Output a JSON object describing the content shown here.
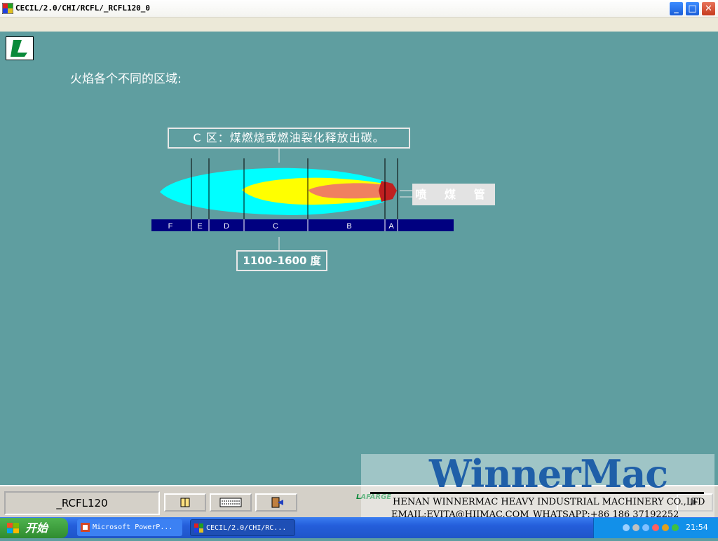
{
  "window": {
    "title": "CECIL/2.0/CHI/RCFL/_RCFL120_0",
    "minimize_glyph": "_",
    "maximize_glyph": "□",
    "close_glyph": "✕"
  },
  "content": {
    "heading": "火焰各个不同的区域:",
    "callout_top": "C 区：煤燃烧或燃油裂化释放出碳。",
    "callout_bottom": "1100–1600 度",
    "burner_label": "喷 煤 管",
    "zones": [
      "F",
      "E",
      "D",
      "C",
      "B",
      "A"
    ]
  },
  "toolbar": {
    "module_name": "_RCFL120",
    "lafarge_text": "LAFARGE",
    "next_glyph": "▶"
  },
  "watermark": {
    "brand_initial": "W",
    "brand_rest": "innerMac",
    "company": "HENAN WINNERMAC HEAVY INDUSTRIAL MACHINERY CO.,LTD",
    "email": "EMAIL:EVITA@HIIMAC.COM",
    "whatsapp": "WHATSAPP:+86 186 37192252"
  },
  "taskbar": {
    "start_label": "开始",
    "tasks": [
      {
        "label": "Microsoft PowerP..."
      },
      {
        "label": "CECIL/2.0/CHI/RC..."
      }
    ],
    "clock": "21:54"
  },
  "colors": {
    "background": "#5F9EA0",
    "flame_outer": "#00FFFF",
    "flame_mid": "#FFFF00",
    "flame_core": "#F08060",
    "zone_bar": "#000080"
  }
}
